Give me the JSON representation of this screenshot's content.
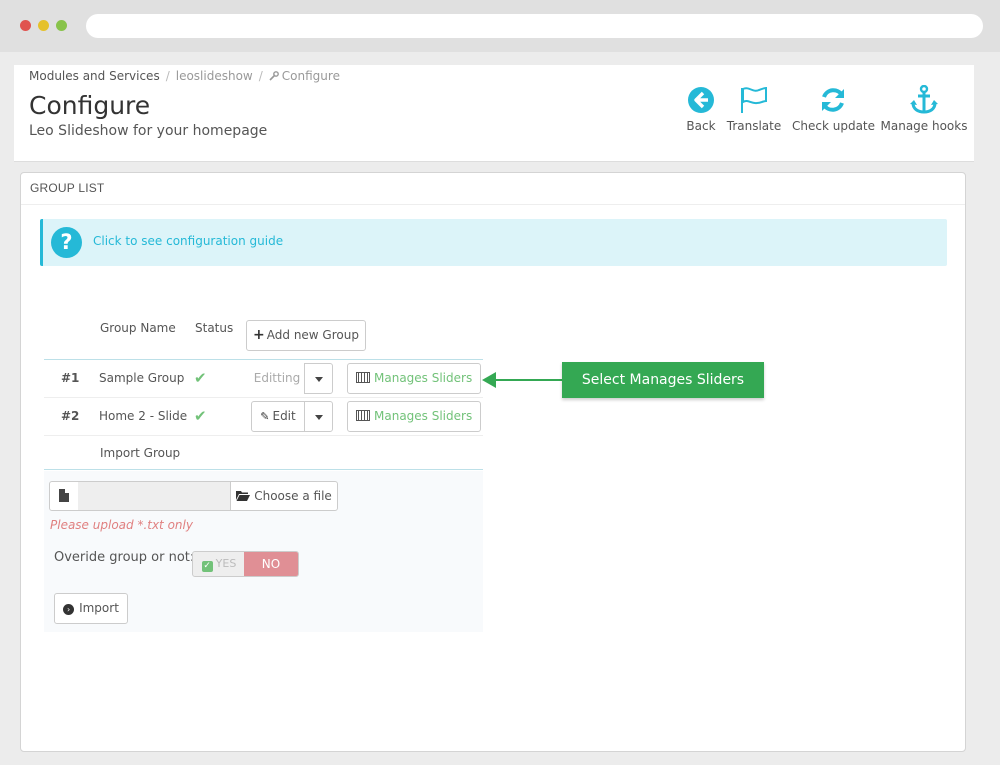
{
  "breadcrumb": {
    "item1": "Modules and Services",
    "item2": "leoslideshow",
    "item3": "Configure"
  },
  "header": {
    "title": "Configure",
    "subtitle": "Leo Slideshow for your homepage"
  },
  "toolbar": {
    "back": "Back",
    "translate": "Translate",
    "check_update": "Check update",
    "manage_hooks": "Manage hooks"
  },
  "panel": {
    "heading": "GROUP LIST"
  },
  "alert": {
    "icon": "?",
    "text": "Click to see configuration guide"
  },
  "table": {
    "col_name": "Group Name",
    "col_status": "Status",
    "add_button": "Add new Group",
    "rows": [
      {
        "num": "#1",
        "name": "Sample Group",
        "action": "Editting",
        "manage": "Manages Sliders"
      },
      {
        "num": "#2",
        "name": "Home 2 - Slide",
        "action": "Edit",
        "manage": "Manages Sliders"
      }
    ],
    "import_label": "Import Group"
  },
  "callout": {
    "text": "Select Manages Sliders"
  },
  "import": {
    "choose_file": "Choose a file",
    "hint": "Please upload *.txt only",
    "override_label": "Overide group or not:",
    "yes": "YES",
    "no": "NO",
    "import_button": "Import"
  },
  "colors": {
    "accent": "#25b9d7",
    "success": "#72c279",
    "callout": "#34a853",
    "danger": "#e08f95"
  },
  "icons": [
    "back-icon",
    "flag-icon",
    "refresh-icon",
    "anchor-icon",
    "question-icon",
    "check-icon",
    "film-icon",
    "file-icon",
    "folder-open-icon",
    "arrow-circle-icon",
    "pencil-icon",
    "plus-icon",
    "wrench-icon"
  ]
}
